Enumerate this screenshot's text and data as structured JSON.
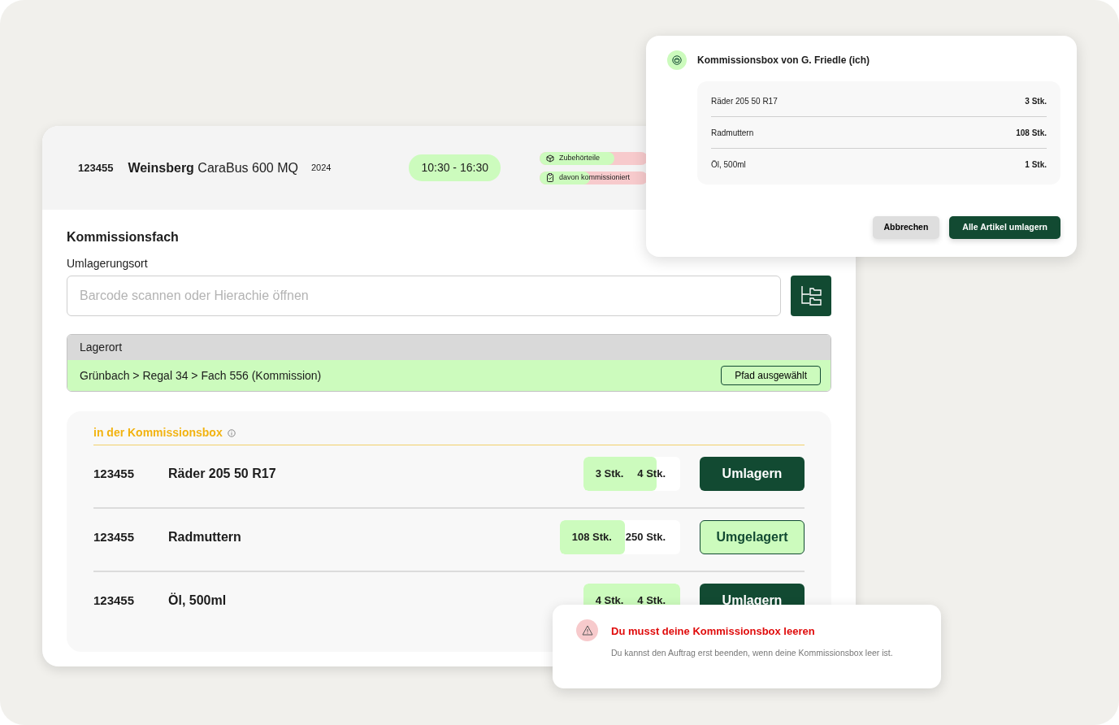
{
  "header": {
    "order_no": "123455",
    "brand": "Weinsberg",
    "model": "CaraBus 600 MQ",
    "year": "2024",
    "time": "10:30 - 16:30",
    "progress": [
      {
        "label": "Zubehörteile",
        "kind": "box",
        "level": 0.69
      },
      {
        "label": "davon kommissioniert",
        "kind": "clipboard",
        "level": 0.47
      }
    ]
  },
  "section_title": "Kommissionsfach",
  "field": {
    "label": "Umlagerungsort",
    "placeholder": "Barcode scannen oder Hierachie öffnen"
  },
  "location": {
    "header": "Lagerort",
    "path": "Grünbach > Regal 34 > Fach 556 (Kommission)",
    "button": "Pfad ausgewählt"
  },
  "box": {
    "title": "in der Kommissionsbox",
    "items": [
      {
        "id": "123455",
        "name": "Räder 205 50 R17",
        "picked": "3 Stk.",
        "total": "4 Stk.",
        "level": 0.76,
        "action": "Umlagern",
        "done": false
      },
      {
        "id": "123455",
        "name": "Radmuttern",
        "picked": "108 Stk.",
        "total": "250 Stk.",
        "level": 0.54,
        "action": "Umgelagert",
        "done": true
      },
      {
        "id": "123455",
        "name": "Öl, 500ml",
        "picked": "4 Stk.",
        "total": "4 Stk.",
        "level": 1,
        "action": "Umlagern",
        "done": false
      }
    ]
  },
  "dialog": {
    "title": "Kommissionsbox von G. Friedle (ich)",
    "items": [
      {
        "name": "Räder 205 50 R17",
        "qty": "3 Stk."
      },
      {
        "name": "Radmuttern",
        "qty": "108 Stk."
      },
      {
        "name": "Öl, 500ml",
        "qty": "1 Stk."
      }
    ],
    "cancel": "Abbrechen",
    "confirm": "Alle Artikel umlagern"
  },
  "toast": {
    "title": "Du musst deine Kommissionsbox leeren",
    "message": "Du kannst den Auftrag erst beenden, wenn deine Kommissionsbox leer ist."
  }
}
